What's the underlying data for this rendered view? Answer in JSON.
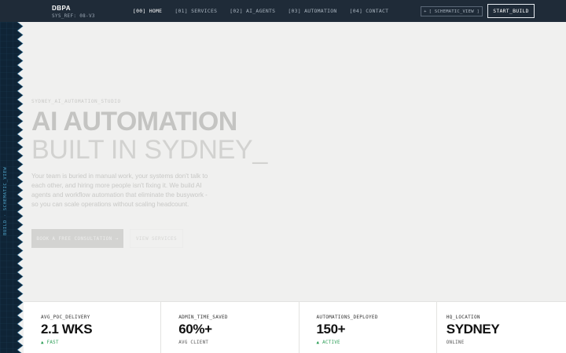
{
  "nav": {
    "brand": "DBPA",
    "sys_ref": "SYS_REF: 08-V3",
    "links": [
      {
        "label": "[00] HOME"
      },
      {
        "label": "[01] SERVICES"
      },
      {
        "label": "[02] AI_AGENTS"
      },
      {
        "label": "[03] AUTOMATION"
      },
      {
        "label": "[04] CONTACT"
      }
    ],
    "schematic_icon": "+",
    "schematic_label": "[ SCHEMATIC_VIEW ]",
    "start_label": "START_BUILD"
  },
  "sidebar": {
    "label": "BUILD · SCHEMATIC_VIEW"
  },
  "hero": {
    "eyebrow": "SYDNEY_AI_AUTOMATION_STUDIO",
    "headline_line1": "AI AUTOMATION",
    "headline_line2": "BUILT IN SYDNEY_",
    "description": "Your team is buried in manual work, your systems don't talk to each other, and hiring more people isn't fixing it. We build AI agents and workflow automation that eliminate the busywork - so you can scale operations without scaling headcount.",
    "primary_cta": "BOOK A FREE CONSULTATION →",
    "secondary_cta": "VIEW SERVICES"
  },
  "stats": [
    {
      "label": "AVG_POC_DELIVERY",
      "value": "2.1 WKS",
      "note": "▲ FAST",
      "note_color": "green"
    },
    {
      "label": "ADMIN_TIME_SAVED",
      "value": "60%+",
      "note": "AVG CLIENT",
      "note_color": "gray"
    },
    {
      "label": "AUTOMATIONS_DEPLOYED",
      "value": "150+",
      "note": "▲ ACTIVE",
      "note_color": "green"
    },
    {
      "label": "HQ_LOCATION",
      "value": "SYDNEY",
      "note": "ONLINE",
      "note_color": "gray"
    }
  ],
  "colors": {
    "nav_bg": "#1f2b38",
    "strip_bg": "#0f2436",
    "accent_blue": "#4ea3c8",
    "accent_green": "#2a9d55"
  }
}
